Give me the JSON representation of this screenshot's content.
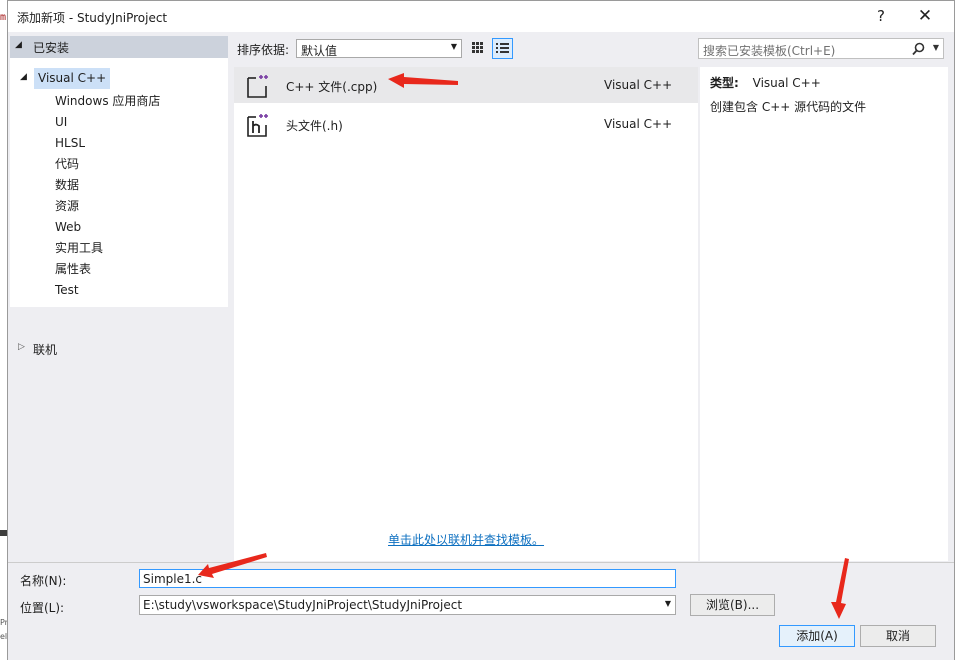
{
  "background_fragments": {
    "top_char": "m",
    "bottom_chars": "Pr\nel"
  },
  "dialog": {
    "title": "添加新项 - StudyJniProject",
    "help_glyph": "?",
    "close_glyph": "✕"
  },
  "sidebar": {
    "header": "已安装",
    "root": "Visual C++",
    "children": [
      "Windows 应用商店",
      "UI",
      "HLSL",
      "代码",
      "数据",
      "资源",
      "Web",
      "实用工具",
      "属性表",
      "Test"
    ],
    "online": "联机"
  },
  "toolbar": {
    "sort_label": "排序依据:",
    "sort_value": "默认值",
    "search_placeholder": "搜索已安装模板(Ctrl+E)"
  },
  "templates": [
    {
      "name": "C++ 文件(.cpp)",
      "lang": "Visual C++",
      "icon": "cpp-file-icon",
      "selected": true
    },
    {
      "name": "头文件(.h)",
      "lang": "Visual C++",
      "icon": "header-file-icon",
      "selected": false
    }
  ],
  "online_link": "单击此处以联机并查找模板。",
  "details": {
    "type_label": "类型:",
    "type_value": "Visual C++",
    "description": "创建包含 C++ 源代码的文件"
  },
  "form": {
    "name_label": "名称(N):",
    "name_value": "Simple1.c",
    "location_label": "位置(L):",
    "location_value": "E:\\study\\vsworkspace\\StudyJniProject\\StudyJniProject",
    "browse_label": "浏览(B)...",
    "add_label": "添加(A)",
    "cancel_label": "取消"
  },
  "colors": {
    "annotation_arrow": "#e8281c",
    "selection": "#cce0f7",
    "link": "#0e70c0",
    "icon_plus": "#7a3fa3"
  }
}
